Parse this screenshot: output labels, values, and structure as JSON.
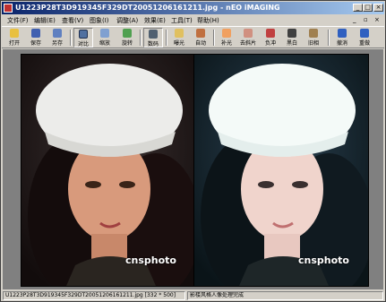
{
  "window": {
    "title": "U1223P28T3D919345F329DT20051206161211.jpg - nEO iMAGING",
    "min": "_",
    "max": "□",
    "close": "×"
  },
  "menu": {
    "items": [
      "文件(F)",
      "编辑(E)",
      "查看(V)",
      "图象(I)",
      "调整(A)",
      "效果(E)",
      "工具(T)",
      "帮助(H)"
    ],
    "right_min": "_",
    "right_restore": "▫",
    "right_close": "×"
  },
  "toolbar": {
    "items": [
      {
        "label": "打开",
        "icon": "folder-open-icon"
      },
      {
        "label": "保存",
        "icon": "save-icon"
      },
      {
        "label": "另存",
        "icon": "save-as-icon"
      },
      {
        "label": "对比",
        "icon": "compare-icon"
      },
      {
        "label": "缩放",
        "icon": "zoom-icon"
      },
      {
        "label": "旋转",
        "icon": "rotate-icon"
      },
      {
        "label": "数码",
        "icon": "digital-icon"
      },
      {
        "label": "曝光",
        "icon": "exposure-icon"
      },
      {
        "label": "自动",
        "icon": "auto-icon"
      },
      {
        "label": "补光",
        "icon": "fill-light-icon"
      },
      {
        "label": "去斜片",
        "icon": "deskew-icon"
      },
      {
        "label": "负冲",
        "icon": "cross-process-icon"
      },
      {
        "label": "黑白",
        "icon": "black-white-icon"
      },
      {
        "label": "旧相",
        "icon": "old-photo-icon"
      },
      {
        "label": "撤消",
        "icon": "undo-icon"
      },
      {
        "label": "重做",
        "icon": "redo-icon"
      }
    ]
  },
  "images": {
    "left_watermark": "cnsphoto",
    "right_watermark": "cnsphoto"
  },
  "status": {
    "file_info": "U1223P28T3D919345F329DT20051206161211.jpg [332 * 500]",
    "message": "影楼风格人像处理完成"
  },
  "colors": {
    "titlebar_start": "#0a246a",
    "titlebar_end": "#a6caf0",
    "workspace": "#808080"
  }
}
